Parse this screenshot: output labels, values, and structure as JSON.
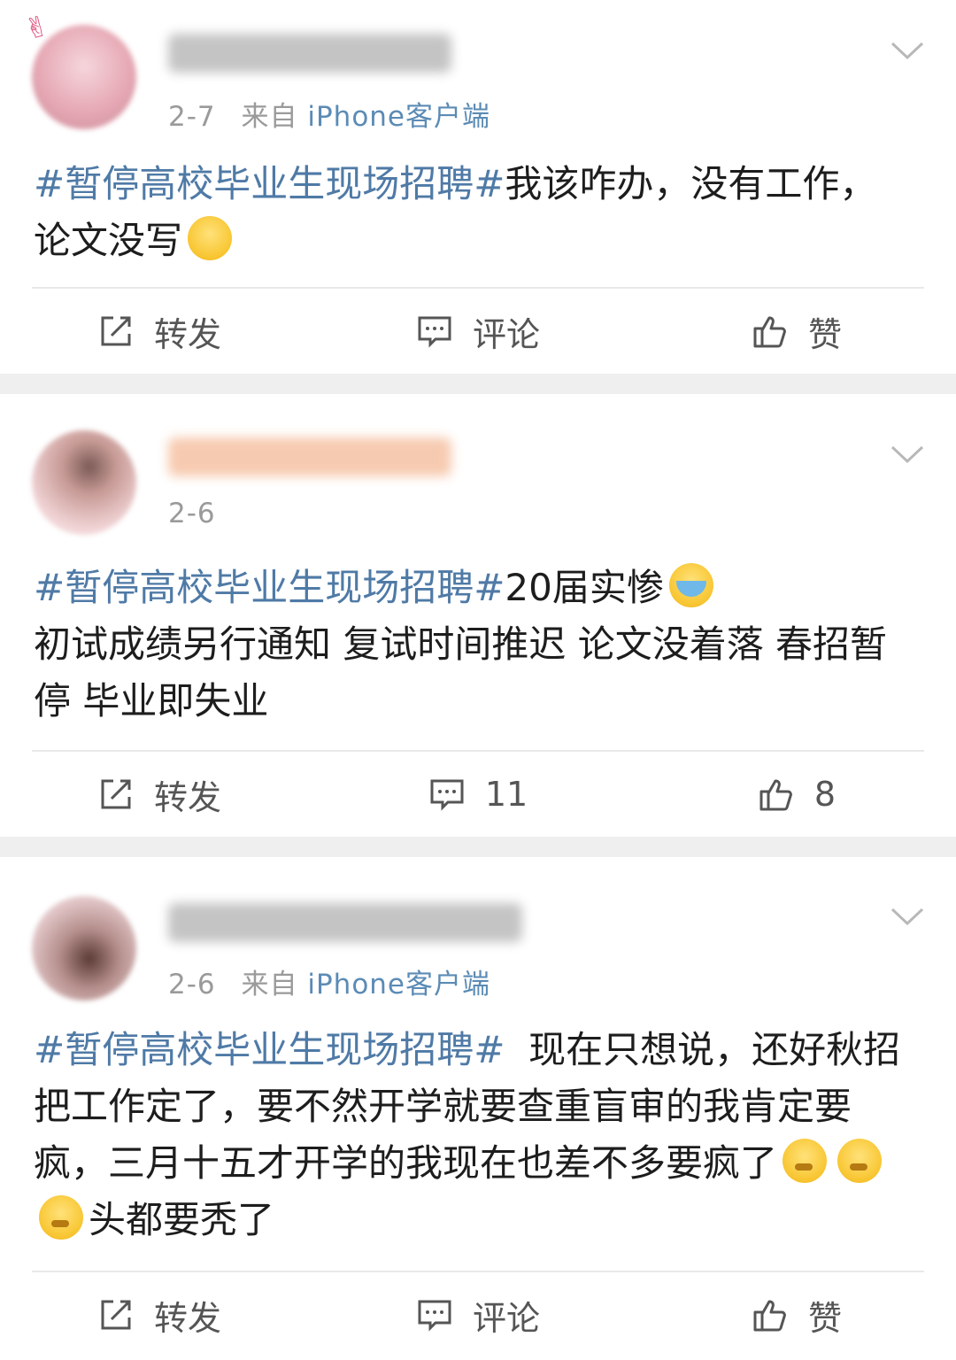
{
  "posts": [
    {
      "time": "2-7",
      "source_prefix": "来自",
      "source": "iPhone客户端",
      "tag": "#暂停高校毕业生现场招聘#",
      "text_before_emoji": "我该咋办，没有工作，论文没写",
      "text_after_emoji": "",
      "emojis": [
        "laugh-cry-emoji"
      ],
      "actions": {
        "repost": "转发",
        "comment": "评论",
        "like": "赞"
      }
    },
    {
      "time": "2-6",
      "source_prefix": "",
      "source": "",
      "tag": "#暂停高校毕业生现场招聘#",
      "text_before_emoji": "20届实惨",
      "text_after_emoji": "初试成绩另行通知 复试时间推迟 论文没着落 春招暂停  毕业即失业",
      "emojis": [
        "crying-emoji"
      ],
      "actions": {
        "repost": "转发",
        "comment": "11",
        "like": "8"
      }
    },
    {
      "time": "2-6",
      "source_prefix": "来自",
      "source": "iPhone客户端",
      "tag": "#暂停高校毕业生现场招聘#",
      "text_before_emoji": "  现在只想说，还好秋招把工作定了，要不然开学就要查重盲审的我肯定要疯，三月十五才开学的我现在也差不多要疯了",
      "text_after_emoji": "头都要秃了",
      "emojis": [
        "thinking-emoji",
        "thinking-emoji",
        "thinking-emoji"
      ],
      "actions": {
        "repost": "转发",
        "comment": "评论",
        "like": "赞"
      }
    }
  ],
  "colors": {
    "hashtag": "#4f7aa6",
    "source": "#5b8bb5",
    "meta": "#9a9a9a",
    "separator": "#efefef"
  },
  "icons": [
    "repost-icon",
    "comment-icon",
    "like-icon",
    "chevron-down-icon"
  ]
}
